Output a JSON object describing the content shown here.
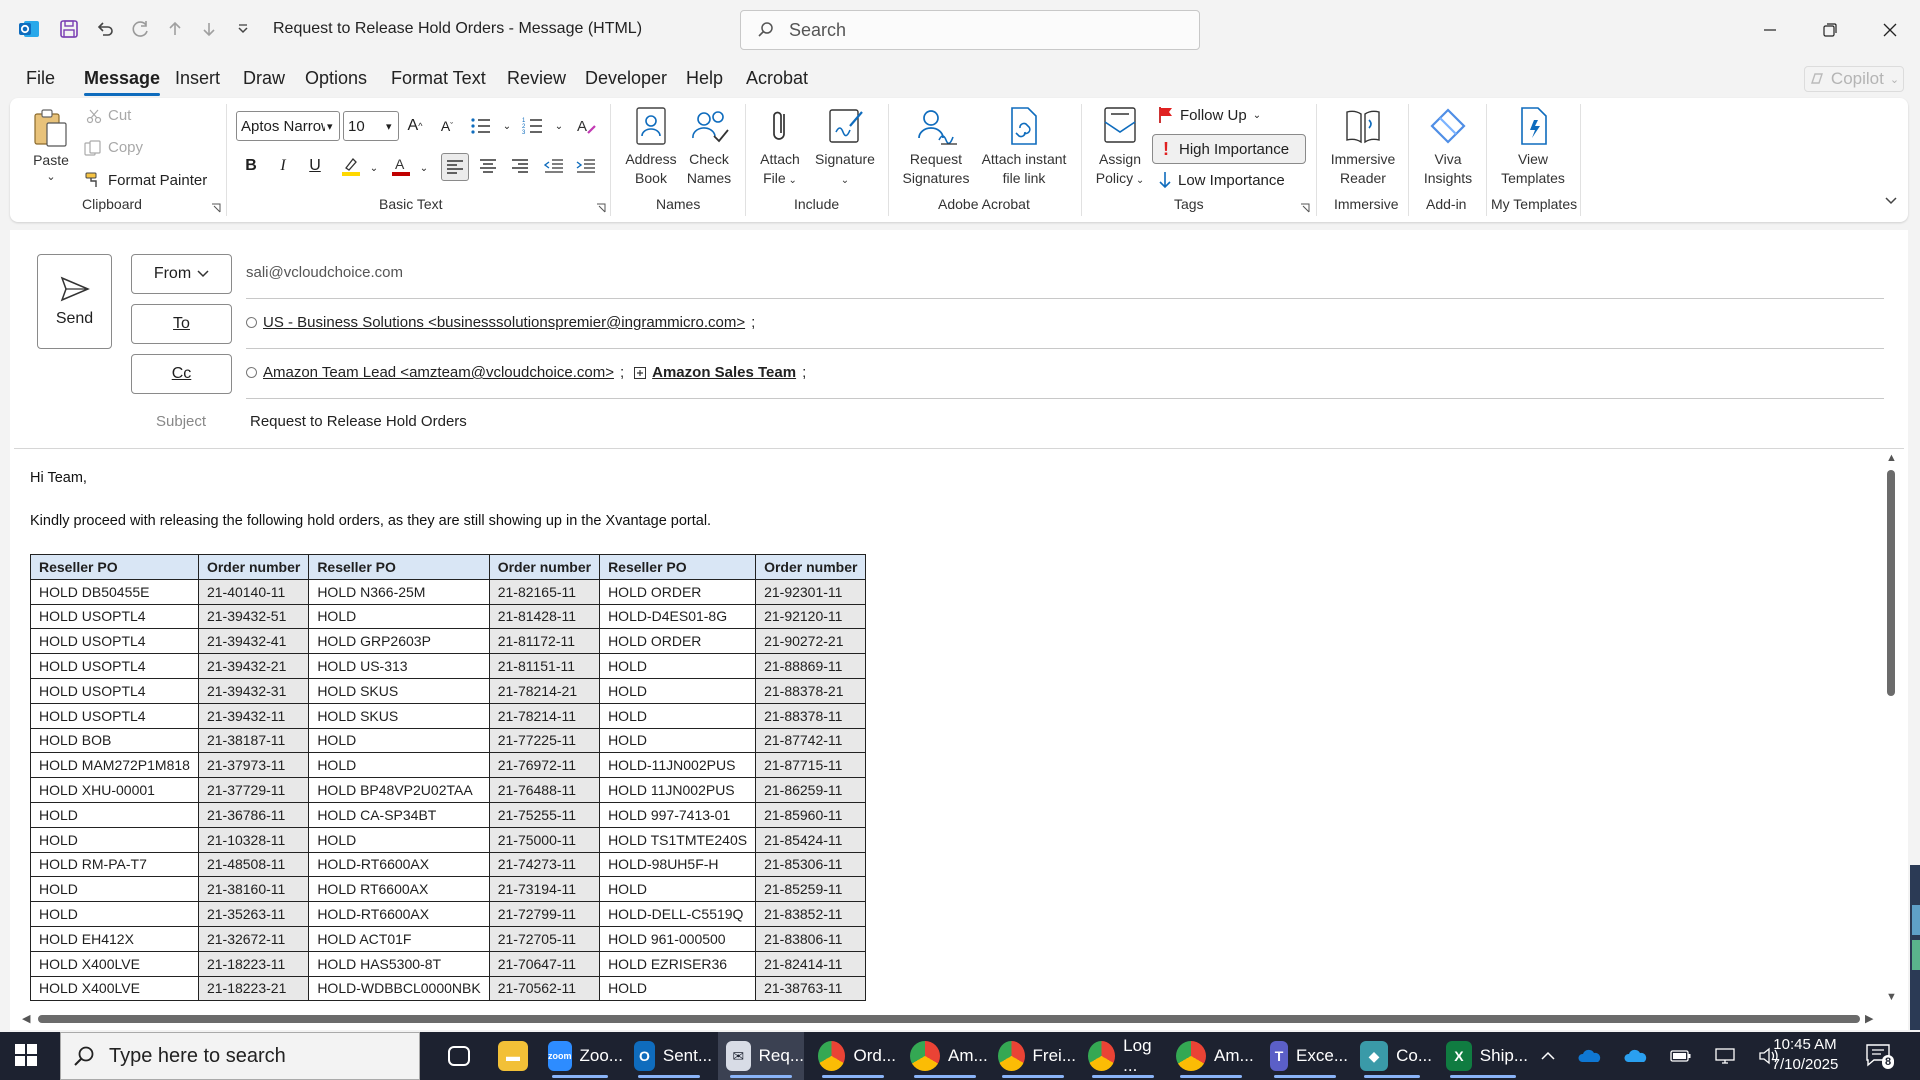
{
  "window": {
    "title": "Request to Release Hold Orders  -  Message (HTML)",
    "search_placeholder": "Search"
  },
  "menu": {
    "tabs": [
      "File",
      "Message",
      "Insert",
      "Draw",
      "Options",
      "Format Text",
      "Review",
      "Developer",
      "Help",
      "Acrobat"
    ],
    "active": "Message",
    "copilot_label": "Copilot"
  },
  "ribbon": {
    "clipboard": {
      "paste": "Paste",
      "cut": "Cut",
      "copy": "Copy",
      "format_painter": "Format Painter",
      "group": "Clipboard"
    },
    "basic_text": {
      "font": "Aptos Narrow",
      "size": "10",
      "group": "Basic Text"
    },
    "names": {
      "address_book_1": "Address",
      "address_book_2": "Book",
      "check_names_1": "Check",
      "check_names_2": "Names",
      "group": "Names"
    },
    "include": {
      "attach_1": "Attach",
      "attach_2": "File",
      "signature": "Signature",
      "group": "Include"
    },
    "adobe": {
      "req_sig_1": "Request",
      "req_sig_2": "Signatures",
      "attach_link_1": "Attach instant",
      "attach_link_2": "file link",
      "group": "Adobe Acrobat"
    },
    "tags": {
      "assign_1": "Assign",
      "assign_2": "Policy",
      "follow_up": "Follow Up",
      "high": "High Importance",
      "low": "Low Importance",
      "group": "Tags"
    },
    "immersive": {
      "label_1": "Immersive",
      "label_2": "Reader",
      "group": "Immersive"
    },
    "addin": {
      "label_1": "Viva",
      "label_2": "Insights",
      "group": "Add-in"
    },
    "templates": {
      "label_1": "View",
      "label_2": "Templates",
      "group": "My Templates"
    },
    "colors": {
      "highlight": "#ffd800",
      "font_color": "#c00000",
      "accent": "#0f6cbd"
    }
  },
  "compose": {
    "send": "Send",
    "from_label": "From",
    "from_value": "sali@vcloudchoice.com",
    "to_label": "To",
    "to_value": "US - Business Solutions <businesssolutionspremier@ingrammicro.com>",
    "cc_label": "Cc",
    "cc_value_1": "Amazon Team Lead <amzteam@vcloudchoice.com>",
    "cc_value_2": "Amazon Sales Team",
    "subject_label": "Subject",
    "subject_value": "Request to Release Hold Orders"
  },
  "body": {
    "greeting": "Hi Team,",
    "intro": "Kindly proceed with releasing the following hold orders, as they are still showing up in the Xvantage portal.",
    "table_headers": [
      "Reseller PO",
      "Order number",
      "Reseller PO",
      "Order number",
      "Reseller PO",
      "Order number"
    ],
    "table_rows": [
      [
        "HOLD DB50455E",
        "21-40140-11",
        "HOLD N366-25M",
        "21-82165-11",
        "HOLD ORDER",
        "21-92301-11"
      ],
      [
        "HOLD USOPTL4",
        "21-39432-51",
        "HOLD",
        "21-81428-11",
        "HOLD-D4ES01-8G",
        "21-92120-11"
      ],
      [
        "HOLD USOPTL4",
        "21-39432-41",
        "HOLD GRP2603P",
        "21-81172-11",
        "HOLD ORDER",
        "21-90272-21"
      ],
      [
        "HOLD USOPTL4",
        "21-39432-21",
        "HOLD US-313",
        "21-81151-11",
        "HOLD",
        "21-88869-11"
      ],
      [
        "HOLD USOPTL4",
        "21-39432-31",
        "HOLD SKUS",
        "21-78214-21",
        "HOLD",
        "21-88378-21"
      ],
      [
        "HOLD USOPTL4",
        "21-39432-11",
        "HOLD SKUS",
        "21-78214-11",
        "HOLD",
        "21-88378-11"
      ],
      [
        "HOLD BOB",
        "21-38187-11",
        "HOLD",
        "21-77225-11",
        "HOLD",
        "21-87742-11"
      ],
      [
        "HOLD MAM272P1M818",
        "21-37973-11",
        "HOLD",
        "21-76972-11",
        "HOLD-11JN002PUS",
        "21-87715-11"
      ],
      [
        "HOLD XHU-00001",
        "21-37729-11",
        "HOLD BP48VP2U02TAA",
        "21-76488-11",
        "HOLD 11JN002PUS",
        "21-86259-11"
      ],
      [
        "HOLD",
        "21-36786-11",
        "HOLD CA-SP34BT",
        "21-75255-11",
        "HOLD 997-7413-01",
        "21-85960-11"
      ],
      [
        "HOLD",
        "21-10328-11",
        "HOLD",
        "21-75000-11",
        "HOLD TS1TMTE240S",
        "21-85424-11"
      ],
      [
        "HOLD RM-PA-T7",
        "21-48508-11",
        "HOLD-RT6600AX",
        "21-74273-11",
        "HOLD-98UH5F-H",
        "21-85306-11"
      ],
      [
        "HOLD",
        "21-38160-11",
        "HOLD RT6600AX",
        "21-73194-11",
        "HOLD",
        "21-85259-11"
      ],
      [
        "HOLD",
        "21-35263-11",
        "HOLD-RT6600AX",
        "21-72799-11",
        "HOLD-DELL-C5519Q",
        "21-83852-11"
      ],
      [
        "HOLD EH412X",
        "21-32672-11",
        "HOLD ACT01F",
        "21-72705-11",
        "HOLD 961-000500",
        "21-83806-11"
      ],
      [
        "HOLD X400LVE",
        "21-18223-11",
        "HOLD HAS5300-8T",
        "21-70647-11",
        "HOLD EZRISER36",
        "21-82414-11"
      ],
      [
        "HOLD X400LVE",
        "21-18223-21",
        "HOLD-WDBBCL0000NBK",
        "21-70562-11",
        "HOLD",
        "21-38763-11"
      ]
    ]
  },
  "taskbar": {
    "search_placeholder": "Type here to search",
    "apps": [
      {
        "icon": "task-view-icon",
        "label": ""
      },
      {
        "icon": "file-explorer-icon",
        "label": ""
      },
      {
        "icon": "zoom-icon",
        "label": "Zoo..."
      },
      {
        "icon": "outlook-icon",
        "label": "Sent..."
      },
      {
        "icon": "mail-compose-icon",
        "label": "Req..."
      },
      {
        "icon": "chrome-icon",
        "label": "Ord..."
      },
      {
        "icon": "chrome-icon",
        "label": "Am..."
      },
      {
        "icon": "chrome-icon",
        "label": "Frei..."
      },
      {
        "icon": "chrome-icon",
        "label": "Log ..."
      },
      {
        "icon": "chrome-icon",
        "label": "Am..."
      },
      {
        "icon": "teams-icon",
        "label": "Exce..."
      },
      {
        "icon": "app-icon",
        "label": "Co..."
      },
      {
        "icon": "excel-icon",
        "label": "Ship..."
      }
    ],
    "time": "10:45 AM",
    "date": "7/10/2025",
    "notifications": "8"
  }
}
